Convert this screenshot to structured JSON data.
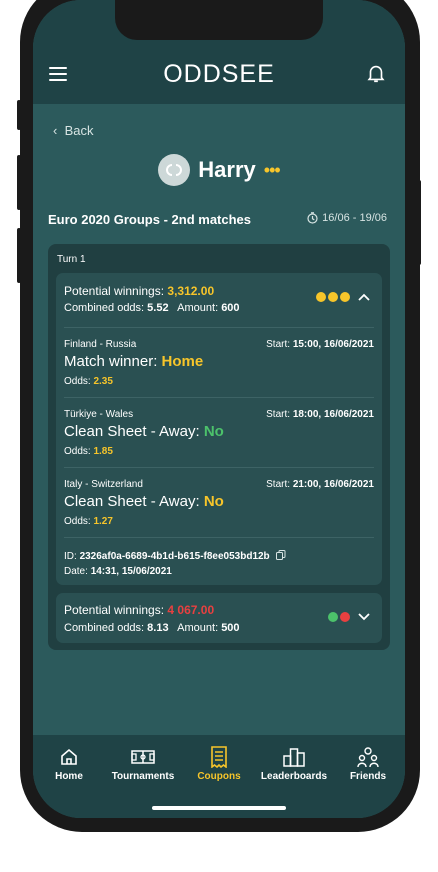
{
  "header": {
    "logo_text": "ODDSEE",
    "menu_icon": "hamburger-icon",
    "bell_icon": "bell-icon"
  },
  "back_label": "Back",
  "user": {
    "name": "Harry",
    "avatar_icon": "oddsee-logo-avatar",
    "status_dots": "•••"
  },
  "tournament": {
    "title": "Euro 2020 Groups - 2nd matches",
    "date_range": "16/06 - 19/06",
    "date_icon": "timer-icon"
  },
  "turn": {
    "label": "Turn 1"
  },
  "coupons": [
    {
      "potential_label": "Potential winnings:",
      "potential_value": "3,312.00",
      "combined_label": "Combined odds:",
      "combined_value": "5.52",
      "amount_label": "Amount:",
      "amount_value": "600",
      "statuses": [
        "pending",
        "pending",
        "pending"
      ],
      "expanded": true,
      "matches": [
        {
          "teams": "Finland - Russia",
          "start_label": "Start:",
          "start_value": "15:00, 16/06/2021",
          "market": "Match winner: ",
          "pick": "Home",
          "pick_color": "#f7c52a",
          "odds_label": "Odds:",
          "odds_value": "2.35"
        },
        {
          "teams": "Türkiye - Wales",
          "start_label": "Start:",
          "start_value": "18:00, 16/06/2021",
          "market": "Clean Sheet - Away: ",
          "pick": "No",
          "pick_color": "#4cc26b",
          "odds_label": "Odds:",
          "odds_value": "1.85"
        },
        {
          "teams": "Italy - Switzerland",
          "start_label": "Start:",
          "start_value": "21:00, 16/06/2021",
          "market": "Clean Sheet - Away: ",
          "pick": "No",
          "pick_color": "#f7c52a",
          "odds_label": "Odds:",
          "odds_value": "1.27"
        }
      ],
      "id_label": "ID:",
      "id_value": "2326af0a-6689-4b1d-b615-f8ee053bd12b",
      "date_label": "Date:",
      "date_value": "14:31, 15/06/2021"
    },
    {
      "potential_label": "Potential winnings:",
      "potential_value": "4 067.00",
      "combined_label": "Combined odds:",
      "combined_value": "8.13",
      "amount_label": "Amount:",
      "amount_value": "500",
      "statuses": [
        "won",
        "lost"
      ],
      "expanded": false
    }
  ],
  "nav": {
    "items": [
      {
        "label": "Home",
        "icon": "home-icon",
        "active": false
      },
      {
        "label": "Tournaments",
        "icon": "pitch-icon",
        "active": false
      },
      {
        "label": "Coupons",
        "icon": "coupon-icon",
        "active": true
      },
      {
        "label": "Leaderboards",
        "icon": "podium-icon",
        "active": false
      },
      {
        "label": "Friends",
        "icon": "friends-icon",
        "active": false
      }
    ]
  },
  "colors": {
    "accent": "#f7c52a",
    "win": "#4cc26b",
    "loss": "#e84040",
    "background": "#2c5a5c",
    "header": "#1f4346"
  }
}
